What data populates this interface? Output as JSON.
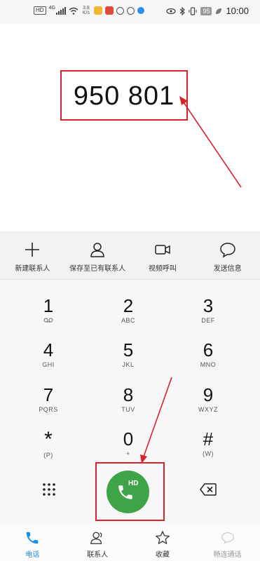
{
  "status_bar": {
    "hd_label": "HD",
    "network_label": "4G",
    "speed_value": "3.8",
    "speed_unit": "K/s",
    "battery": "95",
    "time": "10:00"
  },
  "dialer": {
    "number": "950 801"
  },
  "actions": [
    {
      "label": "新建联系人",
      "icon": "plus-icon"
    },
    {
      "label": "保存至已有联系人",
      "icon": "person-icon"
    },
    {
      "label": "视频呼叫",
      "icon": "video-camera-icon"
    },
    {
      "label": "发送信息",
      "icon": "message-bubble-icon"
    }
  ],
  "keypad": [
    {
      "digit": "1",
      "letters": ""
    },
    {
      "digit": "2",
      "letters": "ABC"
    },
    {
      "digit": "3",
      "letters": "DEF"
    },
    {
      "digit": "4",
      "letters": "GHI"
    },
    {
      "digit": "5",
      "letters": "JKL"
    },
    {
      "digit": "6",
      "letters": "MNO"
    },
    {
      "digit": "7",
      "letters": "PQRS"
    },
    {
      "digit": "8",
      "letters": "TUV"
    },
    {
      "digit": "9",
      "letters": "WXYZ"
    },
    {
      "digit": "*",
      "letters": "(P)"
    },
    {
      "digit": "0",
      "letters": "+"
    },
    {
      "digit": "#",
      "letters": "(W)"
    }
  ],
  "call": {
    "hd_label": "HD",
    "icon": "phone-icon"
  },
  "nav": [
    {
      "label": "电话",
      "icon": "phone-icon",
      "active": true
    },
    {
      "label": "联系人",
      "icon": "contacts-icon",
      "active": false
    },
    {
      "label": "收藏",
      "icon": "star-icon",
      "active": false
    },
    {
      "label": "畅连通话",
      "icon": "chat-call-icon",
      "active": false
    }
  ],
  "colors": {
    "accent": "#1a8ee6",
    "call_green": "#3fa447",
    "annotation_red": "#d9232a"
  }
}
